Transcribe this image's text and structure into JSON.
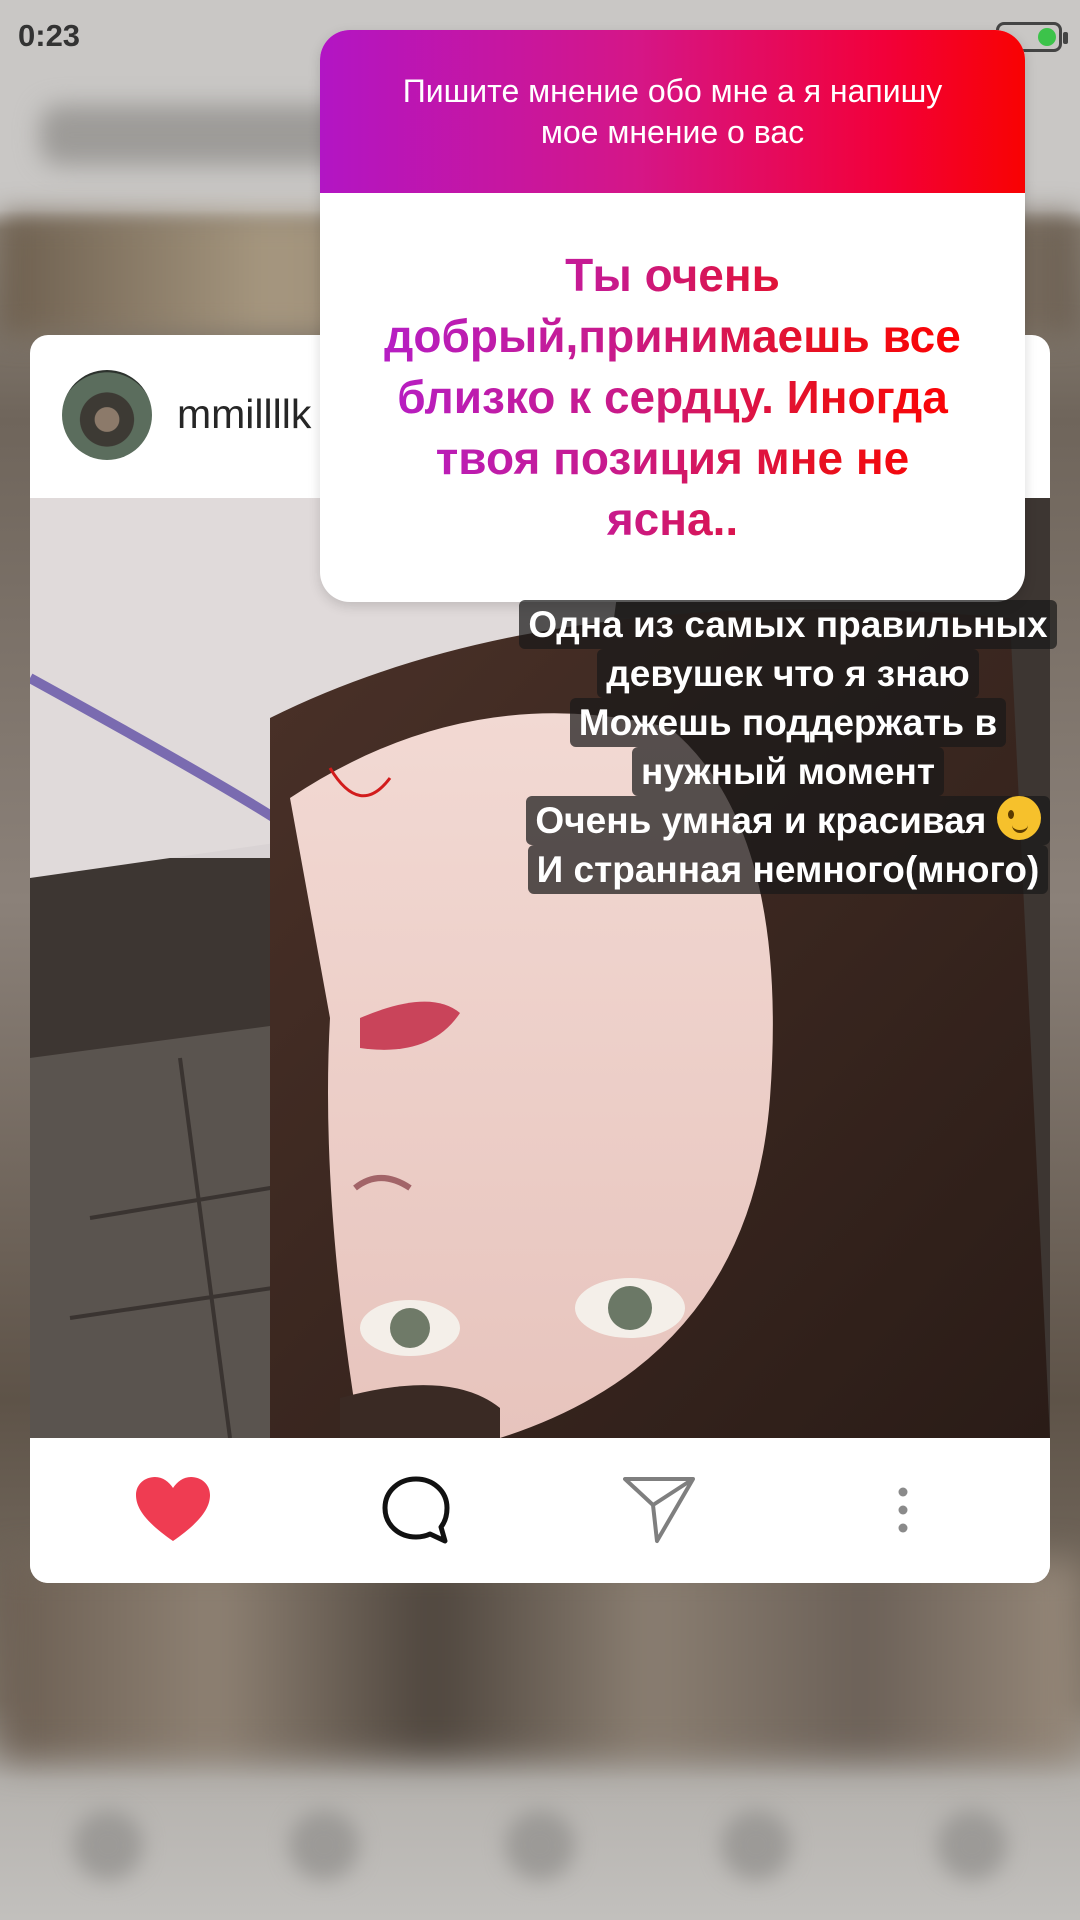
{
  "status_bar": {
    "time": "0:23"
  },
  "post": {
    "username": "mmillllk"
  },
  "sticker": {
    "question": "Пишите мнение обо мне а я напишу мое мнение о вас",
    "answer": "Ты очень добрый,принимаешь все близко к сердцу. Иногда твоя позиция мне  не ясна.."
  },
  "caption": {
    "lines": [
      "Одна из самых правильных",
      "девушек что я знаю",
      "Можешь поддержать в",
      "нужный момент",
      "Очень умная и красивая",
      "И странная немного(много)"
    ]
  },
  "colors": {
    "like": "#ef3c52",
    "gradient_start": "#b215c4",
    "gradient_end": "#f80202"
  },
  "icons": [
    "heart-icon",
    "comment-icon",
    "share-icon",
    "more-icon",
    "wink-emoji-icon",
    "battery-icon"
  ]
}
